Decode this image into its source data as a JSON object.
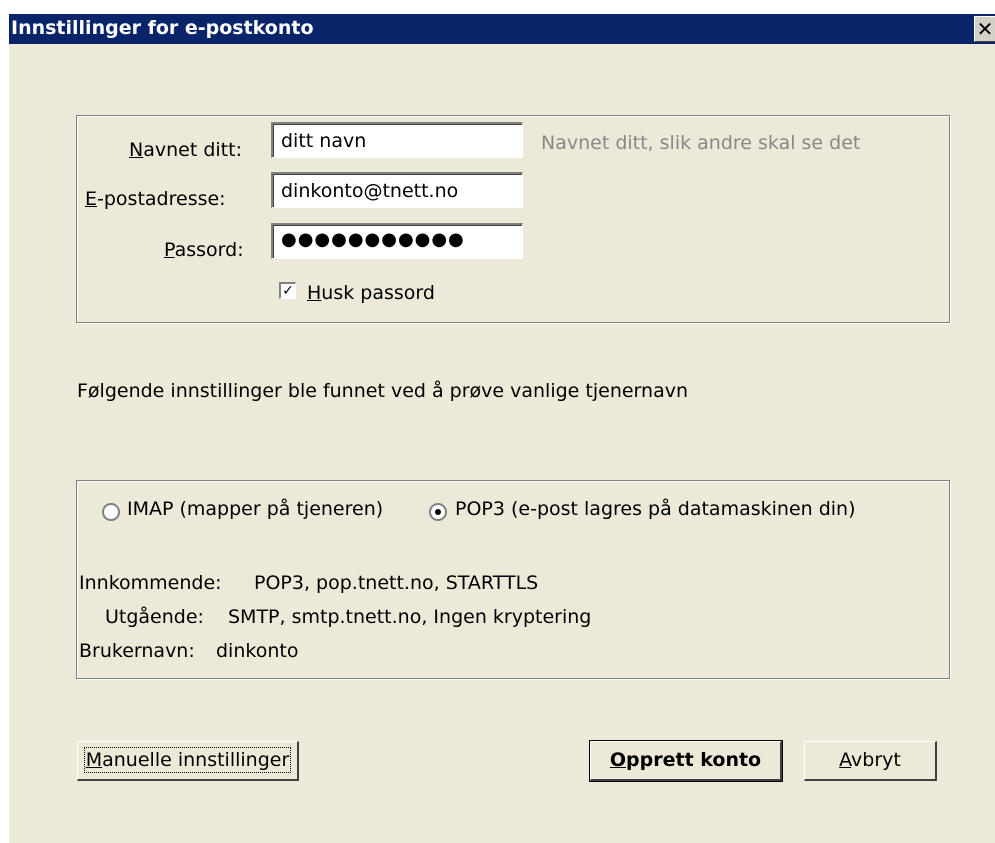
{
  "window": {
    "title": "Innstillinger for e-postkonto",
    "close_symbol": "✕",
    "close_icon": "close-icon"
  },
  "account": {
    "name_label_access": "N",
    "name_label_rest": "avnet ditt:",
    "name_value": "ditt navn",
    "name_hint": "Navnet ditt, slik andre skal se det",
    "email_label_access": "E",
    "email_label_rest": "-postadresse:",
    "email_value": "dinkonto@tnett.no",
    "password_label_access": "P",
    "password_label_rest": "assord:",
    "password_mask": "●●●●●●●●●●●",
    "remember_access": "H",
    "remember_rest": "usk passord",
    "remember_checked": true
  },
  "found_message": "Følgende innstillinger ble funnet ved å prøve vanlige tjenernavn",
  "server": {
    "imap_label": "IMAP (mapper på tjeneren)",
    "pop3_label": "POP3 (e-post lagres på datamaskinen din)",
    "selected": "pop3",
    "incoming_label": "Innkommende:",
    "incoming_value": "POP3, pop.tnett.no, STARTTLS",
    "outgoing_label": "Utgående:",
    "outgoing_value": "SMTP, smtp.tnett.no, Ingen kryptering",
    "username_label": "Brukernavn:",
    "username_value": "dinkonto"
  },
  "buttons": {
    "manual_access": "M",
    "manual_rest": "anuelle innstillinger",
    "create_access": "O",
    "create_rest": "pprett konto",
    "cancel_access": "A",
    "cancel_rest": "vbryt"
  }
}
